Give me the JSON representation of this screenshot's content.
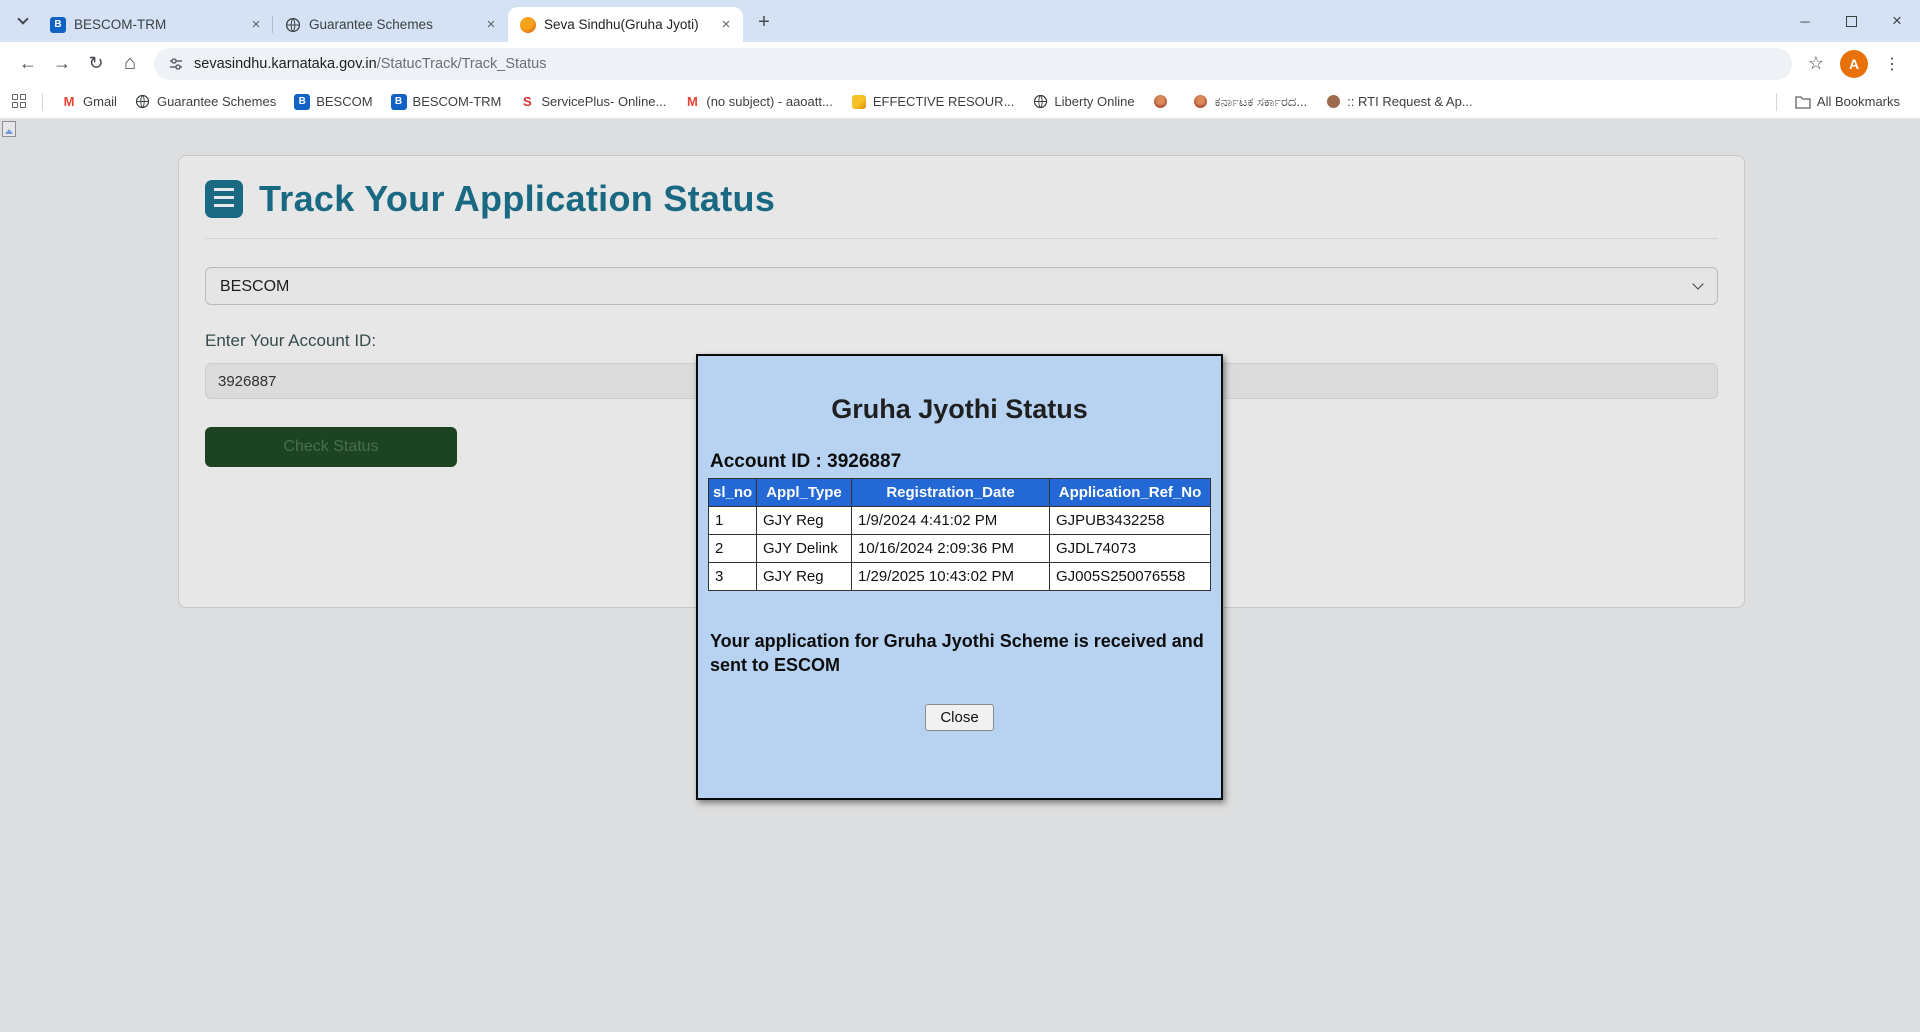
{
  "browser": {
    "tabs": [
      {
        "title": "BESCOM-TRM"
      },
      {
        "title": "Guarantee Schemes"
      },
      {
        "title": "Seva Sindhu(Gruha Jyoti)"
      }
    ],
    "url_domain": "sevasindhu.karnataka.gov.in",
    "url_path": "/StatucTrack/Track_Status",
    "profile_initial": "A",
    "bookmarks": [
      {
        "label": "Gmail"
      },
      {
        "label": "Guarantee Schemes"
      },
      {
        "label": "BESCOM"
      },
      {
        "label": "BESCOM-TRM"
      },
      {
        "label": "ServicePlus- Online..."
      },
      {
        "label": "(no subject) - aaoatt..."
      },
      {
        "label": "EFFECTIVE RESOUR..."
      },
      {
        "label": "Liberty Online"
      },
      {
        "label": ""
      },
      {
        "label": "ಕರ್ನಾಟಕ ಸರ್ಕಾರದ..."
      },
      {
        "label": ":: RTI Request & Ap..."
      }
    ],
    "all_bookmarks_label": "All Bookmarks"
  },
  "icons": {
    "tab_close": "×",
    "new_tab": "+",
    "window_minimize": "─",
    "window_close": "×",
    "back": "←",
    "forward": "→",
    "reload": "↻",
    "home": "⌂",
    "star": "☆",
    "menu_dots": "⋮",
    "gmail_glyph": "M",
    "serviceplus_glyph": "S",
    "bescom_glyph": "B"
  },
  "page": {
    "title": "Track Your Application Status",
    "escom_select_value": "BESCOM",
    "account_label": "Enter Your Account ID:",
    "account_value": "3926887",
    "check_button": "Check Status"
  },
  "modal": {
    "title": "Gruha Jyothi Status",
    "account_line": "Account ID : 3926887",
    "table": {
      "headers": [
        "sl_no",
        "Appl_Type",
        "Registration_Date",
        "Application_Ref_No"
      ],
      "rows": [
        [
          "1",
          "GJY Reg",
          "1/9/2024 4:41:02 PM",
          "GJPUB3432258"
        ],
        [
          "2",
          "GJY Delink",
          "10/16/2024 2:09:36 PM",
          "GJDL74073"
        ],
        [
          "3",
          "GJY Reg",
          "1/29/2025 10:43:02 PM",
          "GJ005S250076558"
        ]
      ]
    },
    "message": "Your application for Gruha Jyothi Scheme is received and sent to ESCOM",
    "close_button": "Close"
  }
}
